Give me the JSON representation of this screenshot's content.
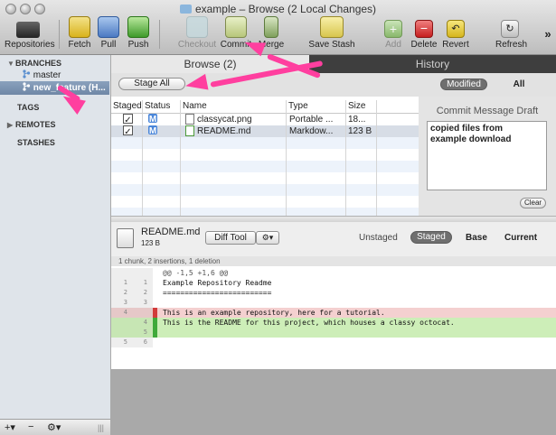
{
  "window": {
    "title": "example – Browse (2 Local Changes)"
  },
  "toolbar": {
    "repositories": "Repositories",
    "fetch": "Fetch",
    "pull": "Pull",
    "push": "Push",
    "checkout": "Checkout",
    "commit": "Commit",
    "merge": "Merge",
    "save_stash": "Save Stash",
    "add": "Add",
    "delete": "Delete",
    "revert": "Revert",
    "refresh": "Refresh",
    "overflow": "»"
  },
  "sidebar": {
    "branches": "BRANCHES",
    "master": "master",
    "new_feature": "new_feature (H...",
    "tags": "TAGS",
    "remotes": "REMOTES",
    "stashes": "STASHES",
    "bottom": {
      "add": "+▾",
      "remove": "−",
      "gear": "⚙▾",
      "handle": "|||"
    }
  },
  "tabs": {
    "browse": "Browse (2)",
    "history": "History"
  },
  "subbar": {
    "stage_all": "Stage All",
    "modified": "Modified",
    "all": "All"
  },
  "files": {
    "columns": [
      "Staged",
      "Status",
      "Name",
      "Type",
      "Size"
    ],
    "rows": [
      {
        "staged": "✓",
        "status": "M",
        "name": "classycat.png",
        "type": "Portable ...",
        "size": "18..."
      },
      {
        "staged": "✓",
        "status": "M",
        "name": "README.md",
        "type": "Markdow...",
        "size": "123 B"
      }
    ]
  },
  "commit_panel": {
    "heading": "Commit Message Draft",
    "message_line1": "copied files from",
    "message_line2": "example download",
    "clear": "Clear"
  },
  "diff_header": {
    "filename": "README.md",
    "filesize": "123 B",
    "diff_tool": "Diff Tool",
    "gear": "⚙▾",
    "unstaged": "Unstaged",
    "staged": "Staged",
    "base": "Base",
    "current": "Current"
  },
  "diff": {
    "summary": "1 chunk, 2 insertions, 1 deletion",
    "lines": [
      {
        "kind": "hunk",
        "old": "",
        "new": "",
        "text": "@@ -1,5 +1,6 @@"
      },
      {
        "kind": "ctx",
        "old": "1",
        "new": "1",
        "text": "Example Repository Readme"
      },
      {
        "kind": "ctx",
        "old": "2",
        "new": "2",
        "text": "========================="
      },
      {
        "kind": "ctx",
        "old": "3",
        "new": "3",
        "text": ""
      },
      {
        "kind": "del",
        "old": "4",
        "new": "",
        "text": "This is an example repository, here for a tutorial."
      },
      {
        "kind": "add",
        "old": "",
        "new": "4",
        "text": "This is the README for this project, which houses a classy octocat."
      },
      {
        "kind": "add",
        "old": "",
        "new": "5",
        "text": ""
      },
      {
        "kind": "ctx",
        "old": "5",
        "new": "6",
        "text": ""
      }
    ]
  },
  "colors": {
    "annotation_arrow": "#ff3f9f",
    "deleted_line": "#f4d0d0",
    "added_line": "#cdeeb8",
    "selected_branch": "#7a92b2"
  }
}
